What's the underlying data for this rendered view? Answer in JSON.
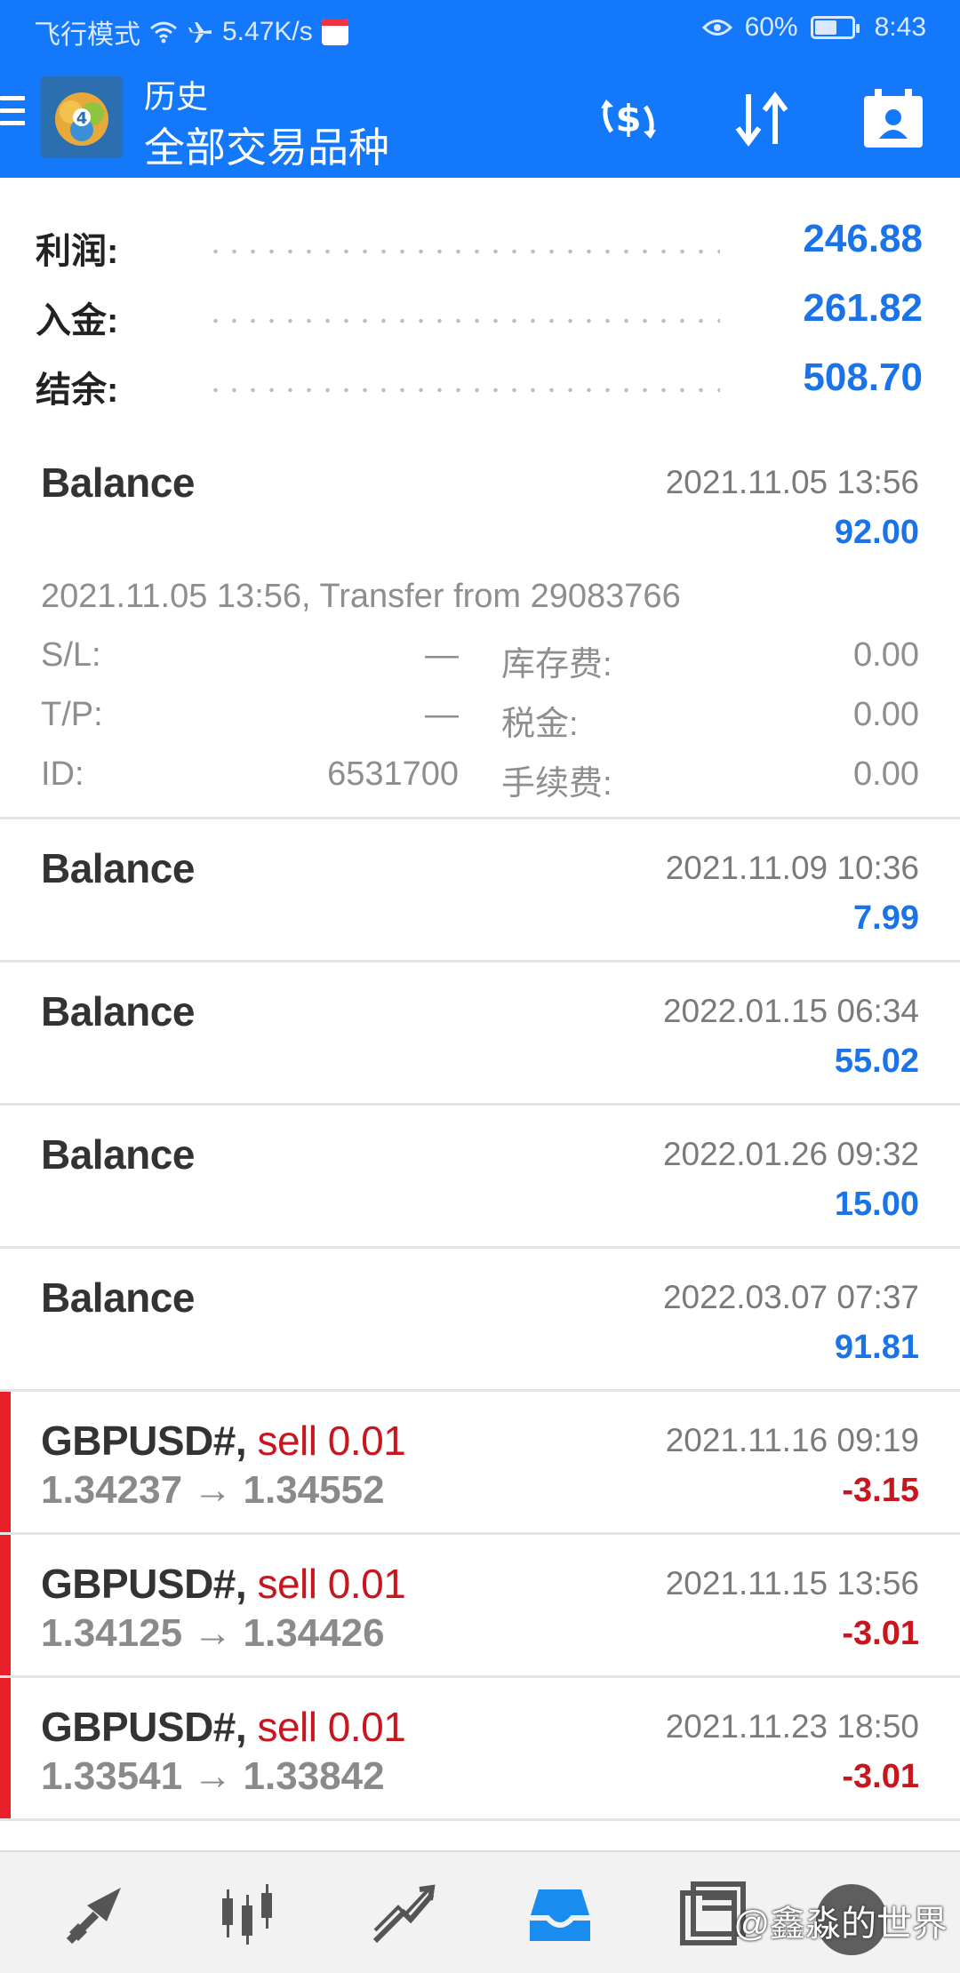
{
  "status_bar": {
    "airplane_mode": "飞行模式",
    "net_speed": "5.47K/s",
    "battery": "60%",
    "battery_level": 0.6,
    "time": "8:43",
    "icons": [
      "wifi-icon",
      "airplane-icon",
      "calendar-app-icon",
      "eye-icon",
      "battery-icon"
    ]
  },
  "app_bar": {
    "subtitle": "历史",
    "title": "全部交易品种",
    "actions": [
      "currency-exchange-icon",
      "sort-icon",
      "calendar-person-icon"
    ],
    "background_color": "#1478fa"
  },
  "summary": {
    "rows": [
      {
        "label": "利润:",
        "value": "246.88"
      },
      {
        "label": "入金:",
        "value": "261.82"
      },
      {
        "label": "结余:",
        "value": "508.70"
      }
    ],
    "value_color": "#1a73e8"
  },
  "history": {
    "expanded": {
      "title": "Balance",
      "time": "2021.11.05 13:56",
      "amount": "92.00",
      "comment": "2021.11.05 13:56, Transfer from 29083766",
      "sl_label": "S/L:",
      "sl_value": "—",
      "tp_label": "T/P:",
      "tp_value": "—",
      "id_label": "ID:",
      "id_value": "6531700",
      "swap_label": "库存费:",
      "swap_value": "0.00",
      "tax_label": "税金:",
      "tax_value": "0.00",
      "fee_label": "手续费:",
      "fee_value": "0.00"
    },
    "balances": [
      {
        "title": "Balance",
        "time": "2021.11.09 10:36",
        "amount": "7.99"
      },
      {
        "title": "Balance",
        "time": "2022.01.15 06:34",
        "amount": "55.02"
      },
      {
        "title": "Balance",
        "time": "2022.01.26 09:32",
        "amount": "15.00"
      },
      {
        "title": "Balance",
        "time": "2022.03.07 07:37",
        "amount": "91.81"
      }
    ],
    "trades": [
      {
        "symbol": "GBPUSD#,",
        "side": "sell 0.01",
        "prices": "1.34237 → 1.34552",
        "time": "2021.11.16 09:19",
        "profit": "-3.15"
      },
      {
        "symbol": "GBPUSD#,",
        "side": "sell 0.01",
        "prices": "1.34125 → 1.34426",
        "time": "2021.11.15 13:56",
        "profit": "-3.01"
      },
      {
        "symbol": "GBPUSD#,",
        "side": "sell 0.01",
        "prices": "1.33541 → 1.33842",
        "time": "2021.11.23 18:50",
        "profit": "-3.01"
      }
    ],
    "loss_color": "#c8161e"
  },
  "bottom_nav": {
    "items": [
      "quotes-icon",
      "chart-candles-icon",
      "trade-icon",
      "history-icon",
      "news-icon"
    ],
    "active": "history-icon",
    "watermark": "@鑫淼的世界"
  }
}
